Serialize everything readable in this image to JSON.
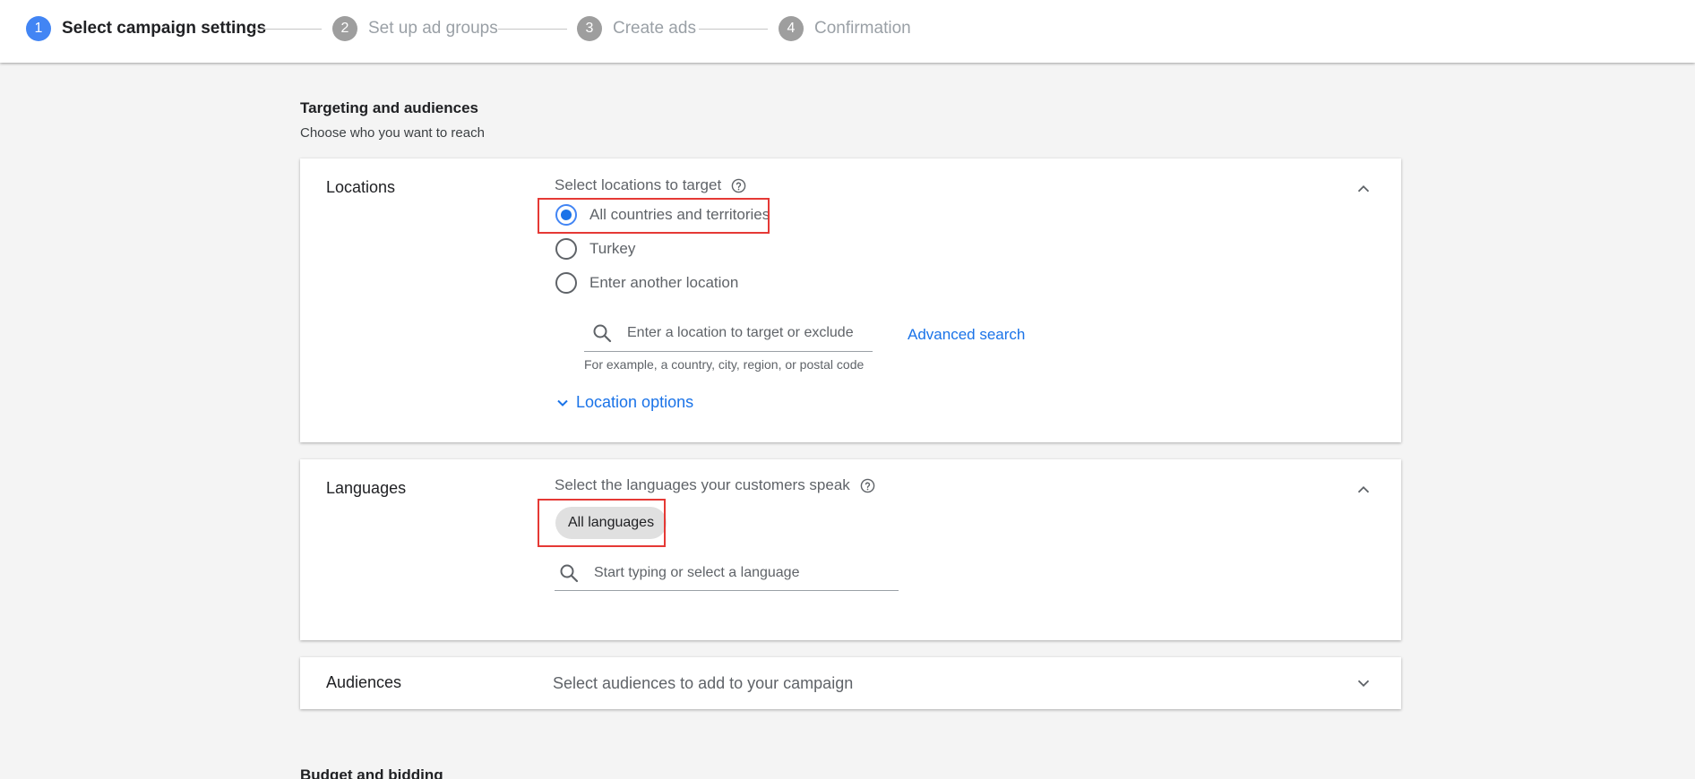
{
  "stepper": {
    "steps": [
      {
        "number": "1",
        "label": "Select campaign settings",
        "active": true
      },
      {
        "number": "2",
        "label": "Set up ad groups",
        "active": false
      },
      {
        "number": "3",
        "label": "Create ads",
        "active": false
      },
      {
        "number": "4",
        "label": "Confirmation",
        "active": false
      }
    ]
  },
  "targeting": {
    "title": "Targeting and audiences",
    "subtitle": "Choose who you want to reach"
  },
  "locations": {
    "title": "Locations",
    "field_label": "Select locations to target",
    "options": [
      {
        "label": "All countries and territories",
        "selected": true
      },
      {
        "label": "Turkey",
        "selected": false
      },
      {
        "label": "Enter another location",
        "selected": false
      }
    ],
    "search_placeholder": "Enter a location to target or exclude",
    "search_hint": "For example, a country, city, region, or postal code",
    "advanced_search": "Advanced search",
    "location_options": "Location options"
  },
  "languages": {
    "title": "Languages",
    "field_label": "Select the languages your customers speak",
    "chip": "All languages",
    "search_placeholder": "Start typing or select a language"
  },
  "audiences": {
    "title": "Audiences",
    "description": "Select audiences to add to your campaign"
  },
  "budget": {
    "title": "Budget and bidding"
  },
  "colors": {
    "accent": "#4285f4",
    "link": "#1a73e8",
    "highlight": "#e53935",
    "inactive_step": "#9e9e9e"
  }
}
